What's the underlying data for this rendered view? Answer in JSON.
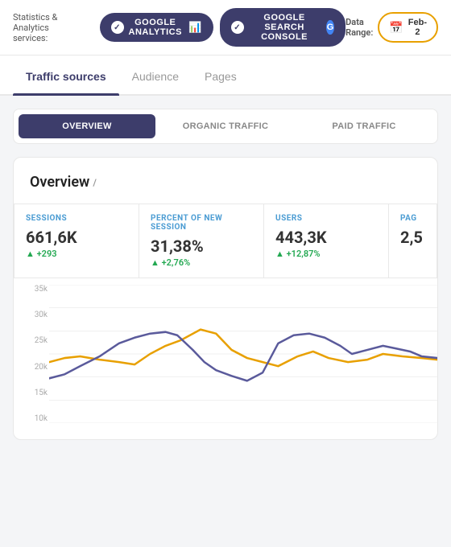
{
  "topBar": {
    "label": "Statistics & Analytics services:",
    "dataRangeLabel": "Data Range:",
    "dateValue": "Feb-2"
  },
  "services": [
    {
      "id": "google-analytics",
      "label": "GOOGLE ANALYTICS",
      "iconType": "bar"
    },
    {
      "id": "google-search-console",
      "label": "GOOGLE SEARCH CONSOLE",
      "iconType": "g"
    }
  ],
  "navTabs": [
    {
      "label": "Traffic sources",
      "active": true
    },
    {
      "label": "Audience",
      "active": false
    },
    {
      "label": "Pages",
      "active": false
    }
  ],
  "subTabs": [
    {
      "label": "OVERVIEW",
      "active": true
    },
    {
      "label": "ORGANIC TRAFFIC",
      "active": false
    },
    {
      "label": "PAID TRAFFIC",
      "active": false
    }
  ],
  "overviewTitle": "Overview",
  "editIconLabel": "/",
  "metrics": [
    {
      "label": "SESSIONS",
      "value": "661,6K",
      "change": "+293",
      "labelColor": "#4b9cd3"
    },
    {
      "label": "PERCENT OF NEW SESSION",
      "value": "31,38%",
      "change": "+2,76%",
      "labelColor": "#888"
    },
    {
      "label": "USERS",
      "value": "443,3K",
      "change": "+12,87%",
      "labelColor": "#888"
    },
    {
      "label": "PAG",
      "value": "2,5",
      "change": "",
      "labelColor": "#888"
    }
  ],
  "chart": {
    "yLabels": [
      "35k",
      "30k",
      "25k",
      "20k",
      "15k",
      "10k"
    ],
    "colors": {
      "blue": "#5a5a9b",
      "orange": "#e8a000"
    }
  }
}
